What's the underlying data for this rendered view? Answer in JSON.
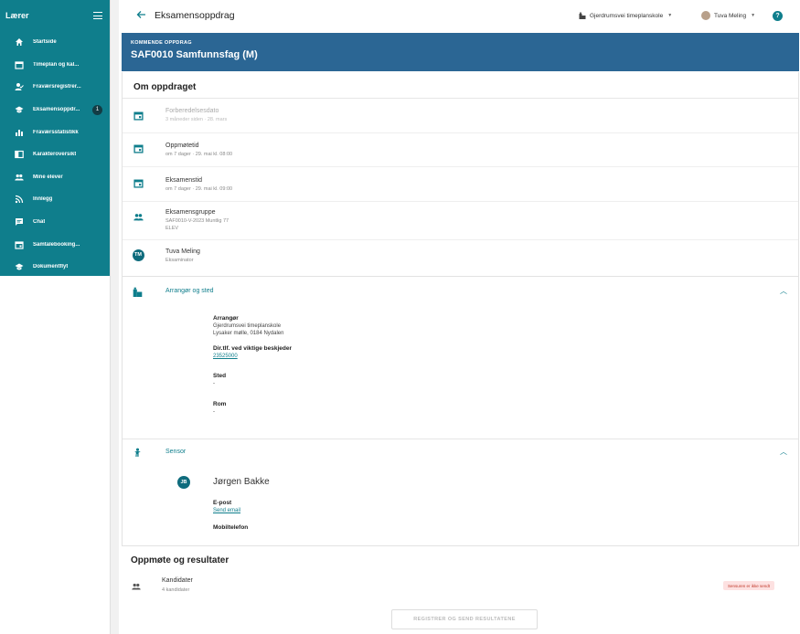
{
  "sidebar": {
    "title": "Lærer",
    "items": [
      {
        "label": "Startside",
        "icon": "home-icon"
      },
      {
        "label": "Timeplan og kal...",
        "icon": "calendar-icon"
      },
      {
        "label": "Fraværsregistrer...",
        "icon": "attendance-icon"
      },
      {
        "label": "Eksamensoppdr...",
        "icon": "school-icon",
        "badge": "1"
      },
      {
        "label": "Fraværsstatistikk",
        "icon": "bar-chart-icon"
      },
      {
        "label": "Karakteroversikt",
        "icon": "grades-icon"
      },
      {
        "label": "Mine elever",
        "icon": "people-icon"
      },
      {
        "label": "Innlegg",
        "icon": "rss-icon"
      },
      {
        "label": "Chat",
        "icon": "chat-icon"
      },
      {
        "label": "Samtalebooking...",
        "icon": "event-icon"
      },
      {
        "label": "Dokumentflyt",
        "icon": "school-icon"
      }
    ]
  },
  "topbar": {
    "title": "Eksamensoppdrag",
    "school": "Gjerdrumsvei timeplanskole",
    "user": "Tuva Meling",
    "help": "?"
  },
  "banner": {
    "kicker": "KOMMENDE OPPDRAG",
    "course": "SAF0010 Samfunnsfag (M)"
  },
  "about": {
    "title": "Om oppdraget",
    "rows": [
      {
        "title": "Forberedelsesdato",
        "sub": "3 måneder siden · 28. mars"
      },
      {
        "title": "Oppmøtetid",
        "sub": "om 7 dager · 29. mai kl. 08:00"
      },
      {
        "title": "Eksamenstid",
        "sub": "om 7 dager · 29. mai kl. 09:00"
      },
      {
        "title": "Eksamensgruppe",
        "sub": "SAF0010-V-2023 Muntlig 77",
        "sub2": "ELEV"
      },
      {
        "title": "Tuva Meling",
        "sub": "Eksaminator",
        "initials": "TM"
      }
    ]
  },
  "arranger": {
    "header": "Arrangør og sted",
    "arr_label": "Arrangør",
    "arr_name": "Gjerdrumsvei timeplanskole",
    "arr_address": "Lysaker mølle, 0184 Nydalen",
    "phone_label": "Dir.tlf. ved viktige beskjeder",
    "phone": "23525000",
    "place_label": "Sted",
    "place": "-",
    "room_label": "Rom",
    "room": "-"
  },
  "sensor": {
    "header": "Sensor",
    "initials": "JB",
    "name": "Jørgen Bakke",
    "email_label": "E-post",
    "email_link": "Send email",
    "phone_label": "Mobiltelefon"
  },
  "results": {
    "title": "Oppmøte og resultater",
    "candidates_label": "Kandidater",
    "candidates_count": "4 kandidater",
    "status": "Sensuren er ikke sendt",
    "register_button": "REGISTRER OG SEND RESULTATENE"
  },
  "colors": {
    "sidebar": "#0f7e8c",
    "banner": "#2b6694",
    "accent": "#0f7e8c"
  }
}
